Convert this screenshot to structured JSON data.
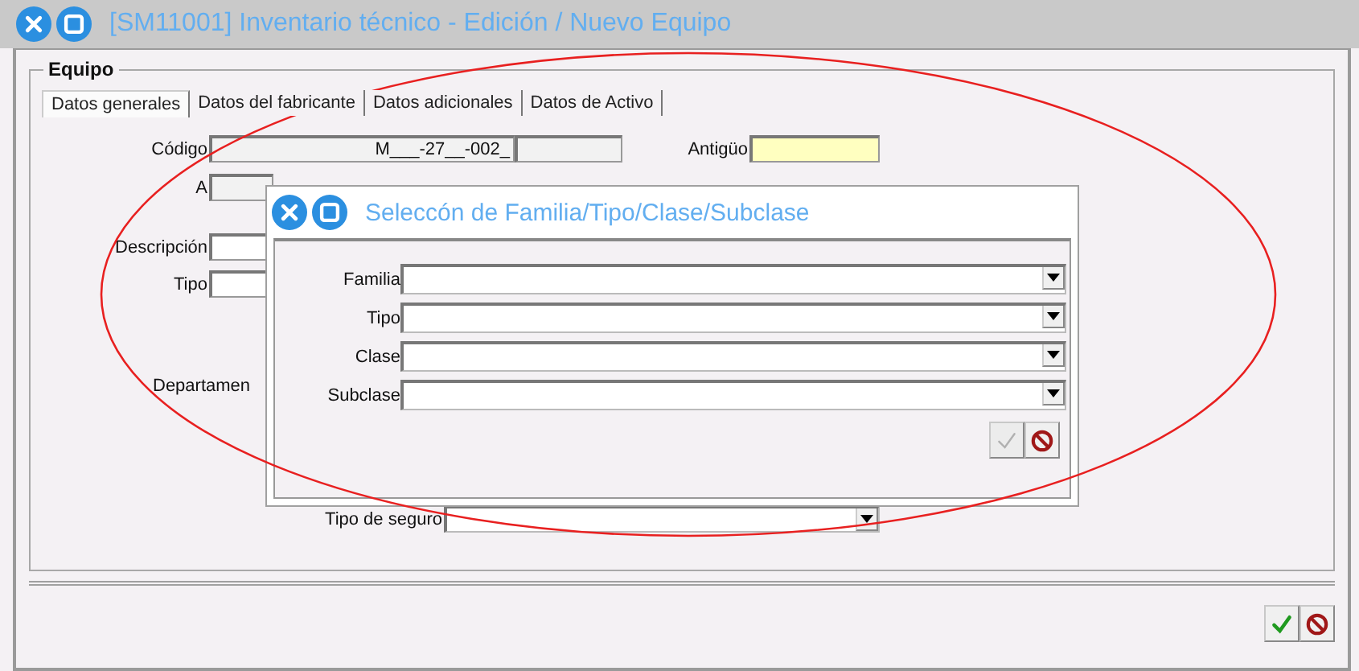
{
  "window": {
    "title": "[SM11001] Inventario técnico - Edición / Nuevo Equipo"
  },
  "group": {
    "title": "Equipo"
  },
  "tabs": [
    {
      "label": "Datos generales",
      "selected": true
    },
    {
      "label": "Datos del fabricante",
      "selected": false
    },
    {
      "label": "Datos adicionales",
      "selected": false
    },
    {
      "label": "Datos de Activo",
      "selected": false
    }
  ],
  "rows": [
    {
      "fields": [
        {
          "label": "Código",
          "kind": "text",
          "value": "M___-27__-002_",
          "highlighted": false
        },
        {
          "kind": "text",
          "highlighted": false
        },
        {
          "label": "Antigüo",
          "kind": "text",
          "highlighted": true
        }
      ]
    },
    {
      "fields": [
        {
          "label": "A",
          "kind": "text",
          "highlighted": false
        }
      ]
    },
    {
      "fields": [
        {
          "label": "Descripción",
          "kind": "text",
          "highlighted": false
        }
      ]
    },
    {
      "fields": [
        {
          "label": "Tipo",
          "kind": "text",
          "highlighted": false
        }
      ]
    },
    {
      "fields": [
        {
          "label": "Departamen",
          "kind": "label"
        }
      ]
    },
    {
      "fields": [
        {
          "label": "Tipo de seguro",
          "kind": "dropdown",
          "highlighted": false
        }
      ]
    }
  ],
  "buttons": [
    {
      "kind": "accept",
      "disabled": false
    },
    {
      "kind": "cancel",
      "disabled": false
    }
  ],
  "dialog": {
    "title": "Seleccón de Familia/Tipo/Clase/Subclase",
    "fields": [
      {
        "label": "Familia",
        "kind": "dropdown"
      },
      {
        "label": "Tipo",
        "kind": "dropdown"
      },
      {
        "label": "Clase",
        "kind": "dropdown"
      },
      {
        "label": "Subclase",
        "kind": "dropdown"
      }
    ],
    "buttons": [
      {
        "kind": "accept",
        "disabled": true
      },
      {
        "kind": "cancel",
        "disabled": false
      }
    ]
  }
}
